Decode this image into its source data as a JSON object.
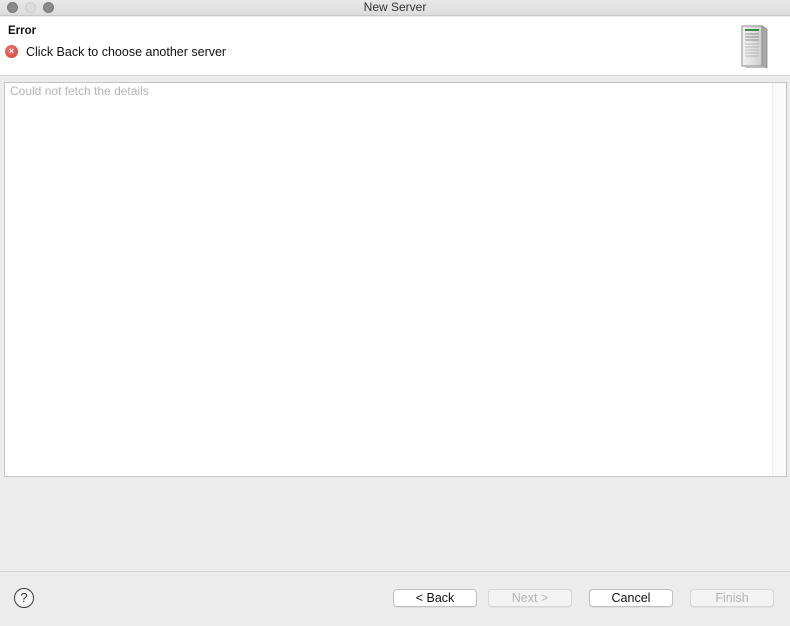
{
  "window": {
    "title": "New Server"
  },
  "header": {
    "title": "Error",
    "message": "Click Back to choose another server",
    "error_icon": "error-x-icon",
    "server_icon": "server-tower-icon"
  },
  "content": {
    "text": "Could not fetch the details"
  },
  "footer": {
    "help_label": "?",
    "back_label": "< Back",
    "next_label": "Next >",
    "cancel_label": "Cancel",
    "finish_label": "Finish"
  },
  "colors": {
    "error": "#d33a30",
    "disabled_text": "#b5b5b5"
  }
}
